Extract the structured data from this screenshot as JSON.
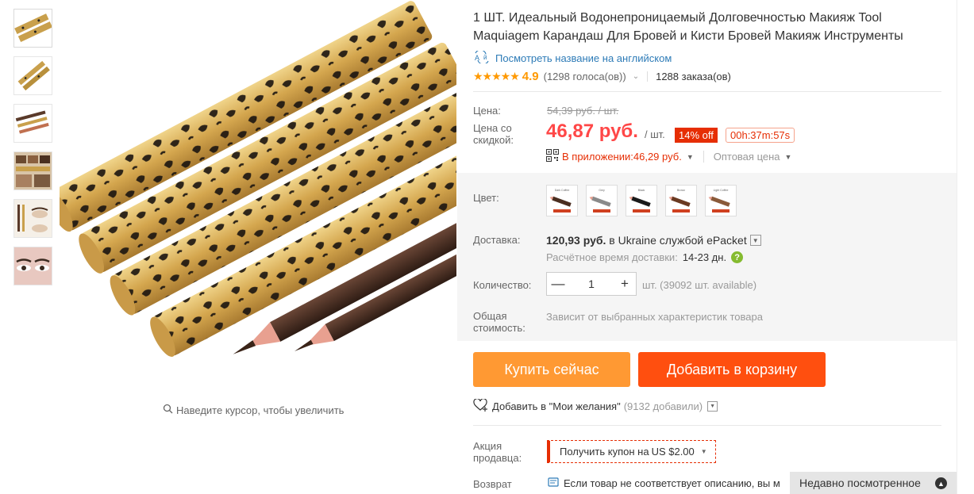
{
  "product": {
    "title": "1 ШТ. Идеальный Водонепроницаемый Долговечностью Макияж Tool Maquiagem Карандаш Для Бровей и Кисти Бровей Макияж Инструменты",
    "translate_link": "Посмотреть название на английском",
    "rating_stars": "★★★★★",
    "rating": "4.9",
    "votes": "(1298 голоса(ов))",
    "orders": "1288 заказа(ов)"
  },
  "gallery": {
    "zoom_hint": "Наведите курсор, чтобы увеличить",
    "thumbnails": [
      "thumb-1",
      "thumb-2",
      "thumb-3",
      "thumb-4",
      "thumb-5",
      "thumb-6"
    ]
  },
  "price": {
    "label": "Цена:",
    "old": "54,39 руб. / шт.",
    "discount_label": "Цена со скидкой:",
    "new": "46,87 руб.",
    "per_unit": "/ шт.",
    "off_badge": "14% off",
    "timer": "00h:37m:57s",
    "app_label": "В приложении:",
    "app_price": "46,29 руб.",
    "wholesale": "Оптовая цена"
  },
  "options": {
    "color_label": "Цвет:",
    "colors": [
      "Dark Coffee",
      "Grey",
      "Black",
      "Brown",
      "Light Coffee"
    ],
    "shipping_label": "Доставка:",
    "shipping_price": "120,93 руб.",
    "shipping_to": "в Ukraine службой ePacket",
    "eta_label": "Расчётное время доставки:",
    "eta_days": "14-23 дн.",
    "qty_label": "Количество:",
    "qty_value": "1",
    "qty_minus": "—",
    "qty_plus": "+",
    "qty_available": "шт. (39092 шт. available)",
    "total_label": "Общая стоимость:",
    "total_value": "Зависит от выбранных характеристик товара"
  },
  "actions": {
    "buy_now": "Купить сейчас",
    "add_to_cart": "Добавить в корзину",
    "wishlist": "Добавить в \"Мои желания\"",
    "wishlist_count": "(9132 добавили)"
  },
  "promo": {
    "label": "Акция продавца:",
    "coupon_text": "Получить купон на",
    "coupon_value": "US $2.00",
    "return_label": "Возврат товара",
    "return_text": "Если товар не соответствует описанию, вы м"
  },
  "recently_viewed": "Недавно посмотренное",
  "colors": {
    "accent": "#ff4747",
    "buy_button": "#ff9933",
    "cart_button": "#ff4f0f",
    "link": "#2d7bb7",
    "star": "#ff9900"
  }
}
